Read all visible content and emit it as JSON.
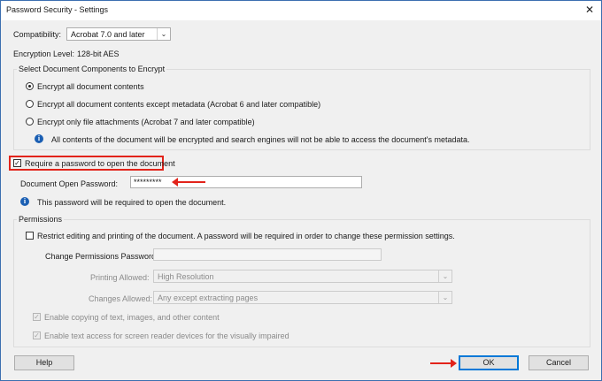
{
  "window": {
    "title": "Password Security - Settings"
  },
  "compatibility": {
    "label": "Compatibility:",
    "value": "Acrobat 7.0 and later"
  },
  "encryption_level": {
    "label": "Encryption  Level:",
    "value": "128-bit AES"
  },
  "components_group": {
    "legend": "Select Document Components to Encrypt",
    "options": [
      {
        "label": "Encrypt all document contents",
        "selected": true
      },
      {
        "label": "Encrypt all document contents except metadata (Acrobat 6 and later compatible)",
        "selected": false
      },
      {
        "label": "Encrypt only file attachments (Acrobat 7 and later compatible)",
        "selected": false
      }
    ],
    "info_text": "All contents of the document will be encrypted and search engines will not be able to access the document's metadata."
  },
  "open_password": {
    "checkbox_label": "Require a password to open the document",
    "checked": true,
    "field_label": "Document Open Password:",
    "value": "*********",
    "info_text": "This password will be required to open the document."
  },
  "permissions": {
    "legend": "Permissions",
    "restrict_label": "Restrict editing and printing of the document. A password will be required in order to change these permission settings.",
    "change_password_label": "Change Permissions Password:",
    "printing_label": "Printing Allowed:",
    "printing_value": "High Resolution",
    "changes_label": "Changes Allowed:",
    "changes_value": "Any except extracting pages",
    "copy_label": "Enable copying of text, images, and other content",
    "screen_reader_label": "Enable text access for screen reader devices for the visually impaired"
  },
  "buttons": {
    "help": "Help",
    "ok": "OK",
    "cancel": "Cancel"
  },
  "icons": {
    "close": "close-icon",
    "info": "info-icon",
    "dropdown": "chevron-down-icon"
  },
  "colors": {
    "highlight": "#e2231a",
    "info": "#1b5fb3",
    "focus": "#0078d7"
  }
}
